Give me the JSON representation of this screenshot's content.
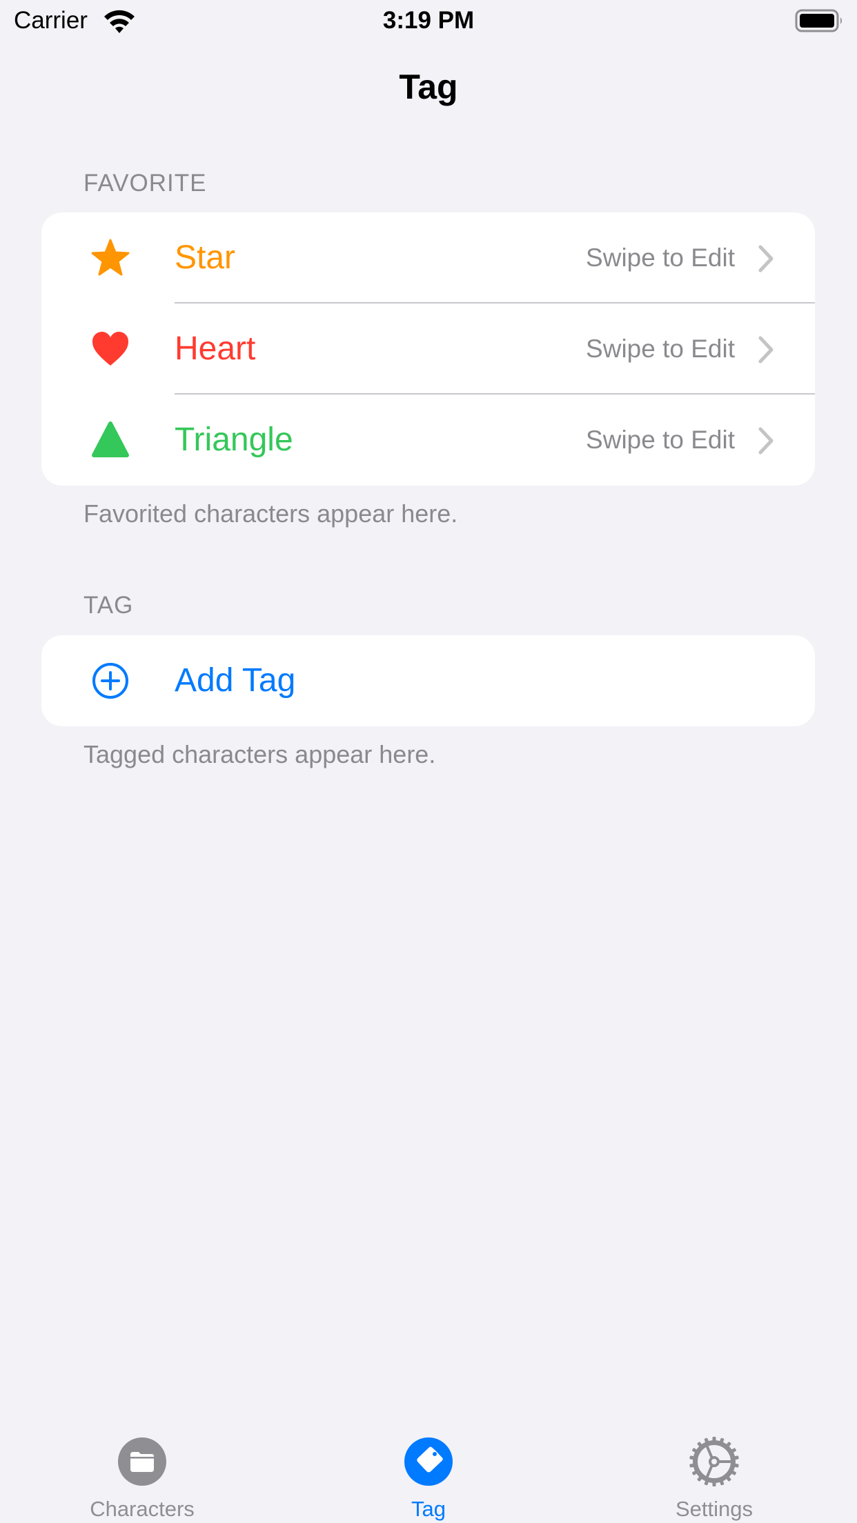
{
  "status_bar": {
    "carrier": "Carrier",
    "time": "3:19 PM",
    "wifi_icon": "wifi-icon",
    "battery_icon": "battery-full-icon"
  },
  "nav": {
    "title": "Tag"
  },
  "favorite_section": {
    "header": "FAVORITE",
    "footer": "Favorited characters appear here.",
    "rows": [
      {
        "icon": "star-icon",
        "label": "Star",
        "detail": "Swipe to Edit",
        "color": "#ff9500"
      },
      {
        "icon": "heart-icon",
        "label": "Heart",
        "detail": "Swipe to Edit",
        "color": "#ff3b30"
      },
      {
        "icon": "triangle-icon",
        "label": "Triangle",
        "detail": "Swipe to Edit",
        "color": "#34c759"
      }
    ]
  },
  "tag_section": {
    "header": "TAG",
    "footer": "Tagged characters appear here.",
    "add_label": "Add Tag",
    "add_icon": "plus-circle-icon",
    "color": "#007aff"
  },
  "tab_bar": {
    "active_color": "#007aff",
    "inactive_color": "#8e8e93",
    "tabs": [
      {
        "label": "Characters",
        "icon": "folder-circle-icon",
        "selected": false
      },
      {
        "label": "Tag",
        "icon": "tag-circle-icon",
        "selected": true
      },
      {
        "label": "Settings",
        "icon": "gear-icon",
        "selected": false
      }
    ]
  }
}
